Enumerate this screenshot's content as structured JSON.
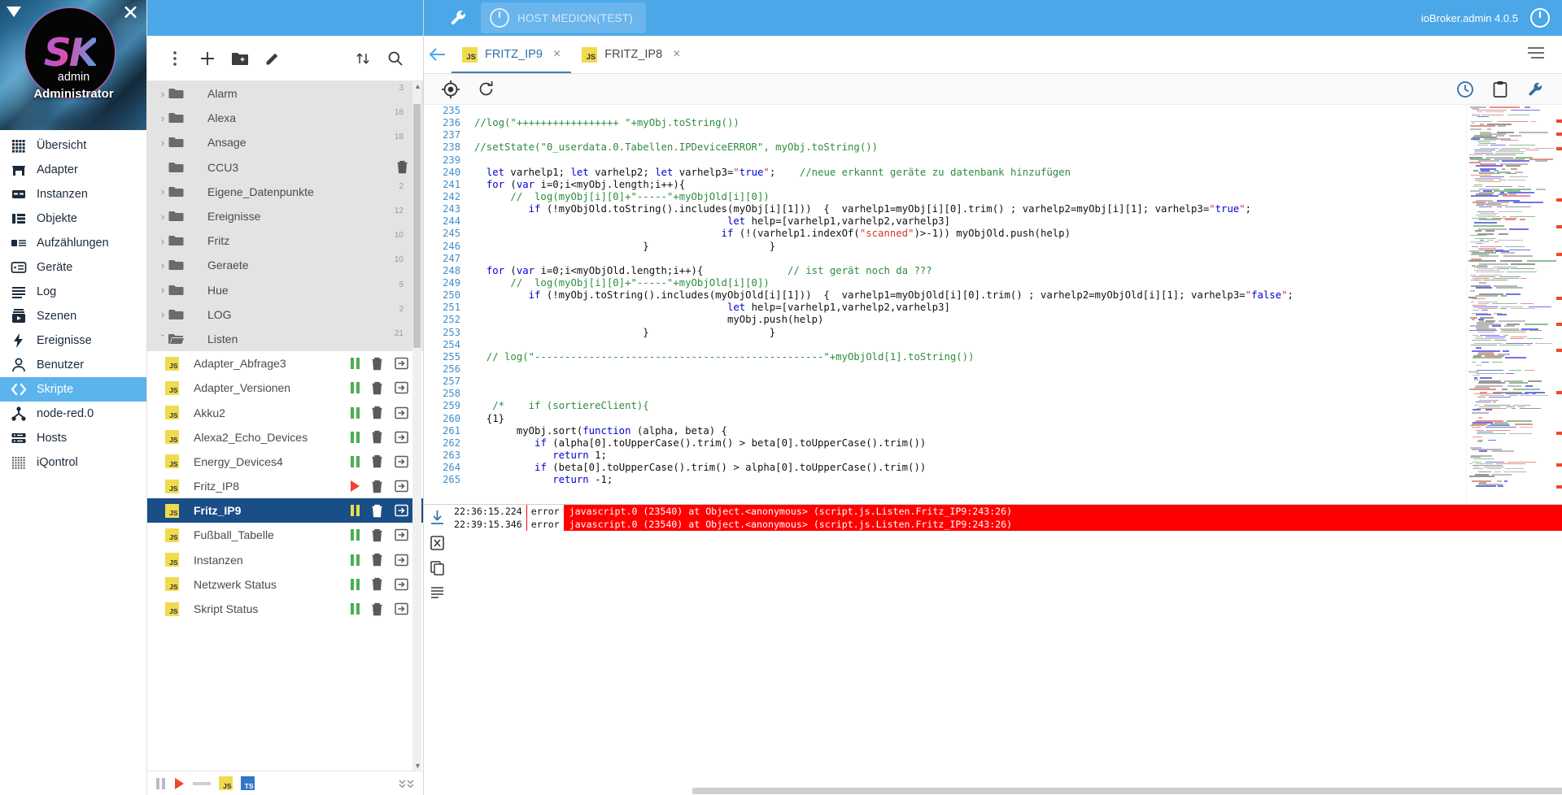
{
  "profile": {
    "username": "admin",
    "role": "Administrator",
    "logo_text": "SK",
    "caret_icon": "triangle-down-icon",
    "close_icon": "close-icon"
  },
  "sidebar": {
    "items": [
      {
        "label": "Übersicht",
        "icon": "grid-icon",
        "active": false
      },
      {
        "label": "Adapter",
        "icon": "store-icon",
        "active": false
      },
      {
        "label": "Instanzen",
        "icon": "instances-icon",
        "active": false
      },
      {
        "label": "Objekte",
        "icon": "objects-icon",
        "active": false
      },
      {
        "label": "Aufzählungen",
        "icon": "enums-icon",
        "active": false
      },
      {
        "label": "Geräte",
        "icon": "devices-icon",
        "active": false
      },
      {
        "label": "Log",
        "icon": "log-icon",
        "active": false
      },
      {
        "label": "Szenen",
        "icon": "scenes-icon",
        "active": false
      },
      {
        "label": "Ereignisse",
        "icon": "bolt-icon",
        "active": false
      },
      {
        "label": "Benutzer",
        "icon": "user-icon",
        "active": false
      },
      {
        "label": "Skripte",
        "icon": "code-icon",
        "active": true
      },
      {
        "label": "node-red.0",
        "icon": "nodered-icon",
        "active": false
      },
      {
        "label": "Hosts",
        "icon": "server-icon",
        "active": false
      },
      {
        "label": "iQontrol",
        "icon": "dots-grid-icon",
        "active": false
      }
    ]
  },
  "tree_toolbar": {
    "buttons": [
      {
        "name": "more-vert-icon",
        "title": "more"
      },
      {
        "name": "add-icon",
        "title": "add script"
      },
      {
        "name": "new-folder-icon",
        "title": "new folder"
      },
      {
        "name": "edit-icon",
        "title": "rename"
      },
      {
        "name": "expand-collapse-icon",
        "title": "expand/collapse"
      },
      {
        "name": "search-icon",
        "title": "search"
      }
    ]
  },
  "tree": {
    "rows": [
      {
        "type": "folder",
        "label": "Alarm",
        "count": "3",
        "expanded": false,
        "twist": "›"
      },
      {
        "type": "folder",
        "label": "Alexa",
        "count": "18",
        "expanded": false,
        "twist": "›"
      },
      {
        "type": "folder",
        "label": "Ansage",
        "count": "18",
        "expanded": false,
        "twist": "›"
      },
      {
        "type": "folder",
        "label": "CCU3",
        "count": "",
        "expanded": false,
        "twist": "",
        "trash": true
      },
      {
        "type": "folder",
        "label": "Eigene_Datenpunkte",
        "count": "2",
        "expanded": false,
        "twist": "›"
      },
      {
        "type": "folder",
        "label": "Ereignisse",
        "count": "12",
        "expanded": false,
        "twist": "›"
      },
      {
        "type": "folder",
        "label": "Fritz",
        "count": "10",
        "expanded": false,
        "twist": "›"
      },
      {
        "type": "folder",
        "label": "Geraete",
        "count": "10",
        "expanded": false,
        "twist": "›"
      },
      {
        "type": "folder",
        "label": "Hue",
        "count": "5",
        "expanded": false,
        "twist": "›"
      },
      {
        "type": "folder",
        "label": "LOG",
        "count": "2",
        "expanded": false,
        "twist": "›"
      },
      {
        "type": "folder",
        "label": "Listen",
        "count": "21",
        "expanded": true,
        "twist": "ˇ"
      },
      {
        "type": "script",
        "label": "Adapter_Abfrage3",
        "state": "paused",
        "selected": false
      },
      {
        "type": "script",
        "label": "Adapter_Versionen",
        "state": "paused",
        "selected": false
      },
      {
        "type": "script",
        "label": "Akku2",
        "state": "paused",
        "selected": false
      },
      {
        "type": "script",
        "label": "Alexa2_Echo_Devices",
        "state": "paused",
        "selected": false
      },
      {
        "type": "script",
        "label": "Energy_Devices4",
        "state": "paused",
        "selected": false
      },
      {
        "type": "script",
        "label": "Fritz_IP8",
        "state": "running",
        "selected": false
      },
      {
        "type": "script",
        "label": "Fritz_IP9",
        "state": "paused",
        "selected": true
      },
      {
        "type": "script",
        "label": "Fußball_Tabelle",
        "state": "paused",
        "selected": false
      },
      {
        "type": "script",
        "label": "Instanzen",
        "state": "paused",
        "selected": false
      },
      {
        "type": "script",
        "label": "Netzwerk Status",
        "state": "paused",
        "selected": false
      },
      {
        "type": "script",
        "label": "Skript Status",
        "state": "paused",
        "selected": false
      }
    ]
  },
  "tree_footer": {
    "icons": [
      "pause-icon",
      "play-icon",
      "resize-icon",
      "js-badge",
      "ts-badge",
      "chevrons-icon"
    ],
    "js_label": "JS",
    "ts_label": "TS"
  },
  "topbar": {
    "wrench_icon": "wrench-icon",
    "host_label": "HOST MEDION(TEST)",
    "power_icon": "power-icon",
    "version": "ioBroker.admin 4.0.5",
    "right_power_icon": "power-icon"
  },
  "tabs": {
    "back_icon": "arrow-left-icon",
    "menu_icon": "hamburger-icon",
    "items": [
      {
        "label": "FRITZ_IP9",
        "badge": "JS",
        "active": true,
        "close": "×"
      },
      {
        "label": "FRITZ_IP8",
        "badge": "JS",
        "active": false,
        "close": "×"
      }
    ]
  },
  "editor_toolbar": {
    "left_icons": [
      "target-icon",
      "refresh-icon"
    ],
    "right_icons": [
      "history-icon",
      "clipboard-icon",
      "wrench-icon"
    ]
  },
  "code": {
    "first_line": 235,
    "lines": [
      {
        "n": 235,
        "text": ""
      },
      {
        "n": 236,
        "text": "//log(\"+++++++++++++++++ \"+myObj.toString())",
        "style": "comment"
      },
      {
        "n": 237,
        "text": ""
      },
      {
        "n": 238,
        "text": "//setState(\"0_userdata.0.Tabellen.IPDeviceERROR\", myObj.toString())",
        "style": "comment"
      },
      {
        "n": 239,
        "text": ""
      },
      {
        "n": 240,
        "text": "  let varhelp1; let varhelp2; let varhelp3=\"true\";    //neue erkannt geräte zu datenbank hinzufügen"
      },
      {
        "n": 241,
        "text": "  for (var i=0;i<myObj.length;i++){"
      },
      {
        "n": 242,
        "text": "      //  log(myObj[i][0]+\"-----\"+myObjOld[i][0])",
        "style": "comment"
      },
      {
        "n": 243,
        "text": "         if (!myObjOld.toString().includes(myObj[i][1]))  {  varhelp1=myObj[i][0].trim() ; varhelp2=myObj[i][1]; varhelp3=\"true\";"
      },
      {
        "n": 244,
        "text": "                                          let help=[varhelp1,varhelp2,varhelp3]"
      },
      {
        "n": 245,
        "text": "                                         if (!(varhelp1.indexOf(\"scanned\")>-1)) myObjOld.push(help)"
      },
      {
        "n": 246,
        "text": "                            }                    }"
      },
      {
        "n": 247,
        "text": ""
      },
      {
        "n": 248,
        "text": "  for (var i=0;i<myObjOld.length;i++){              // ist gerät noch da ???"
      },
      {
        "n": 249,
        "text": "      //  log(myObj[i][0]+\"-----\"+myObjOld[i][0])",
        "style": "comment"
      },
      {
        "n": 250,
        "text": "         if (!myObj.toString().includes(myObjOld[i][1]))  {  varhelp1=myObjOld[i][0].trim() ; varhelp2=myObjOld[i][1]; varhelp3=\"false\";"
      },
      {
        "n": 251,
        "text": "                                          let help=[varhelp1,varhelp2,varhelp3]"
      },
      {
        "n": 252,
        "text": "                                          myObj.push(help)"
      },
      {
        "n": 253,
        "text": "                            }                    }"
      },
      {
        "n": 254,
        "text": ""
      },
      {
        "n": 255,
        "text": "  // log(\"------------------------------------------------\"+myObjOld[1].toString())",
        "style": "comment"
      },
      {
        "n": 256,
        "text": ""
      },
      {
        "n": 257,
        "text": ""
      },
      {
        "n": 258,
        "text": ""
      },
      {
        "n": 259,
        "text": "   /*    if (sortiereClient){",
        "style": "comment"
      },
      {
        "n": 260,
        "text": "  {1}"
      },
      {
        "n": 261,
        "text": "       myObj.sort(function (alpha, beta) {"
      },
      {
        "n": 262,
        "text": "          if (alpha[0].toUpperCase().trim() > beta[0].toUpperCase().trim())"
      },
      {
        "n": 263,
        "text": "             return 1;"
      },
      {
        "n": 264,
        "text": "          if (beta[0].toUpperCase().trim() > alpha[0].toUpperCase().trim())"
      },
      {
        "n": 265,
        "text": "             return -1;"
      }
    ]
  },
  "log": {
    "side_icons": [
      "download-icon",
      "clear-icon",
      "copy-icon",
      "list-icon"
    ],
    "entries": [
      {
        "timestamp": "22:36:15.224",
        "severity": "error",
        "message": "javascript.0 (23540) at Object.<anonymous> (script.js.Listen.Fritz_IP9:243:26)"
      },
      {
        "timestamp": "22:39:15.346",
        "severity": "error",
        "message": "javascript.0 (23540) at Object.<anonymous> (script.js.Listen.Fritz_IP9:243:26)"
      }
    ]
  },
  "colors": {
    "accent": "#4ba7e8",
    "selected_row": "#1a4e86",
    "error_bg": "#ff0000",
    "js_badge": "#f0db4f",
    "running": "#f4442e",
    "paused": "#4caf50"
  }
}
